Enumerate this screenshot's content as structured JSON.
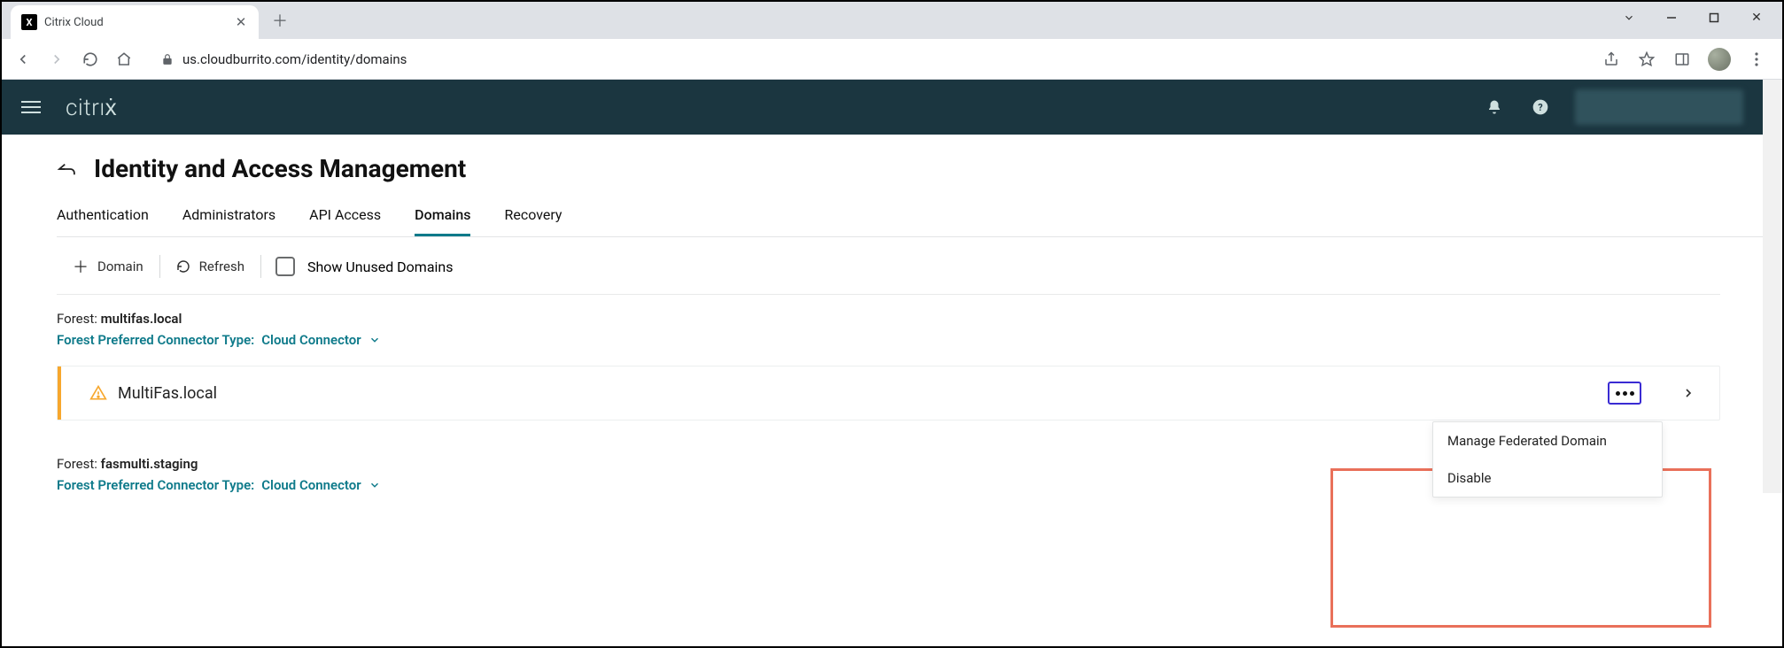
{
  "browser": {
    "tab_title": "Citrix Cloud",
    "url": "us.cloudburrito.com/identity/domains"
  },
  "app": {
    "brand": "citrıẋ"
  },
  "page": {
    "title": "Identity and Access Management"
  },
  "tabs": {
    "authentication": "Authentication",
    "administrators": "Administrators",
    "api_access": "API Access",
    "domains": "Domains",
    "recovery": "Recovery"
  },
  "actions": {
    "add_domain": "Domain",
    "refresh": "Refresh",
    "show_unused": "Show Unused Domains"
  },
  "forests": [
    {
      "label_prefix": "Forest:",
      "name": "multifas.local",
      "connector_prefix": "Forest Preferred Connector Type:",
      "connector_value": "Cloud Connector",
      "domain": "MultiFas.local"
    },
    {
      "label_prefix": "Forest:",
      "name": "fasmulti.staging",
      "connector_prefix": "Forest Preferred Connector Type:",
      "connector_value": "Cloud Connector"
    }
  ],
  "dropdown": {
    "manage": "Manage Federated Domain",
    "disable": "Disable"
  }
}
